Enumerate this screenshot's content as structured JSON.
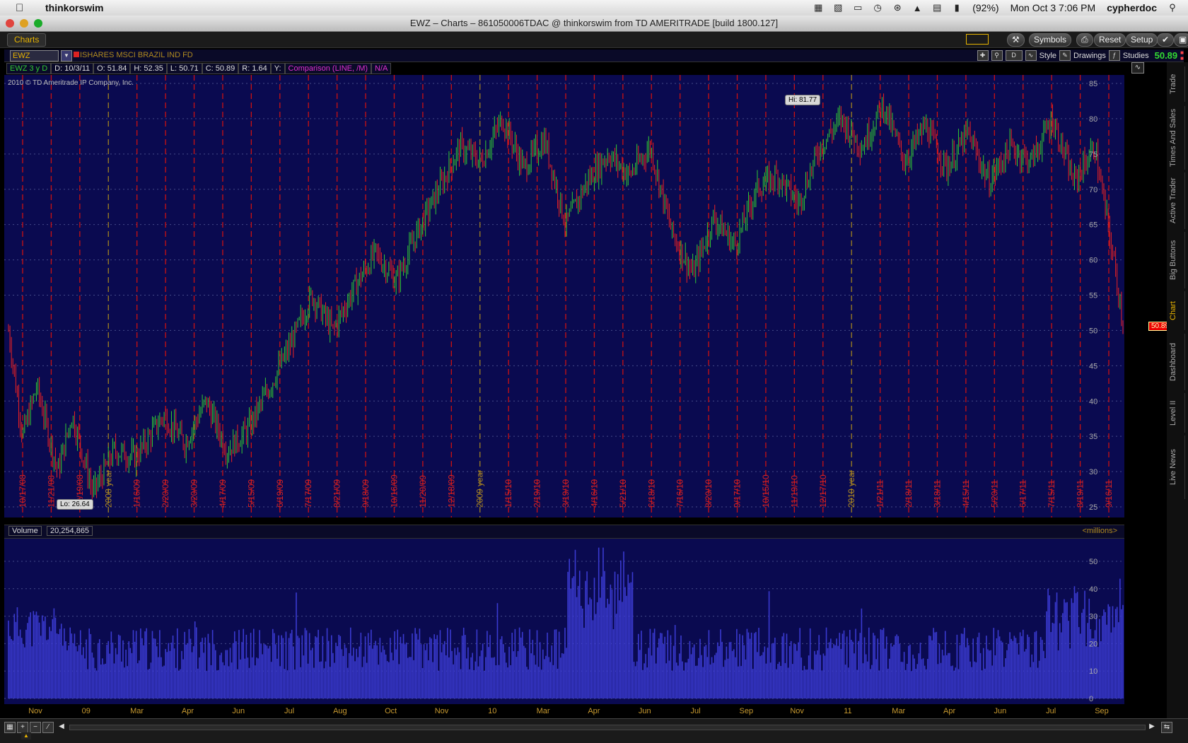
{
  "menubar": {
    "app_name": "thinkorswim",
    "battery": "(92%)",
    "datetime": "Mon Oct 3  7:06 PM",
    "user": "cypherdoc"
  },
  "window": {
    "title": "EWZ – Charts – 861050006TDAC @ thinkorswim from TD AMERITRADE [build 1800.127]"
  },
  "toolbar": {
    "tab_label": "Charts",
    "symbols_label": "Symbols",
    "reset_label": "Reset",
    "setup_label": "Setup"
  },
  "symbol_row": {
    "symbol": "EWZ",
    "description": "ISHARES MSCI BRAZIL IND FD",
    "period": "D",
    "style_label": "Style",
    "drawings_label": "Drawings",
    "studies_label": "Studies",
    "last_price": "50.89"
  },
  "info_row": {
    "chart_label": "EWZ 3 y D",
    "date": "D: 10/3/11",
    "open": "O: 51.84",
    "high": "H: 52.35",
    "low": "L: 50.71",
    "close": "C: 50.89",
    "range": "R: 1.64",
    "y_label": "Y:",
    "comparison": "Comparison (LINE, /M)",
    "na": "N/A"
  },
  "copyright": "2010 © TD Ameritrade IP Company, Inc.",
  "annotations": {
    "hi": "Hi: 81.77",
    "lo": "Lo: 26.64",
    "price_tag": "50.89"
  },
  "volume_panel": {
    "label": "Volume",
    "value": "20,254,865",
    "unit": "<millions>"
  },
  "side_tabs": [
    "Trade",
    "Times And Sales",
    "Active Trader",
    "Big Buttons",
    "Chart",
    "Dashboard",
    "Level II",
    "Live News"
  ],
  "colors": {
    "bg": "#0a0a50",
    "up": "#33cc33",
    "down": "#ee2222",
    "grid_red": "#cc1111",
    "volume": "#3a3ad0"
  },
  "chart_data": [
    {
      "type": "line",
      "price_axis": {
        "min": 25,
        "max": 85,
        "ticks": [
          25,
          30,
          35,
          40,
          45,
          50,
          55,
          60,
          65,
          70,
          75,
          80,
          85
        ]
      },
      "vertical_date_labels": [
        "10/17/08",
        "11/21/08",
        "12/19/08",
        "2008 year",
        "1/16/09",
        "2/20/09",
        "3/20/09",
        "4/17/09",
        "5/15/09",
        "6/19/09",
        "7/17/09",
        "8/21/09",
        "9/18/09",
        "10/16/09",
        "11/20/09",
        "12/18/09",
        "2009 year",
        "1/15/10",
        "2/19/10",
        "3/19/10",
        "4/16/10",
        "5/21/10",
        "6/18/10",
        "7/16/10",
        "8/20/10",
        "9/17/10",
        "10/15/10",
        "11/19/10",
        "12/17/10",
        "2010 year",
        "1/21/11",
        "2/18/11",
        "3/18/11",
        "4/15/11",
        "5/20/11",
        "6/17/11",
        "7/15/11",
        "8/19/11",
        "9/16/11"
      ],
      "series": [
        {
          "name": "",
          "x_index": [
            0,
            2,
            4,
            7,
            9,
            12,
            15,
            18,
            22,
            25,
            28,
            31,
            34,
            37,
            40,
            43,
            46,
            49,
            52,
            55,
            58,
            61,
            64,
            67,
            70,
            73,
            76,
            79,
            82,
            85,
            88,
            91,
            94,
            97,
            100,
            103,
            106,
            109,
            112,
            115,
            118,
            121,
            124,
            127,
            130,
            133,
            136,
            139,
            142,
            145,
            148,
            151,
            154,
            157,
            158
          ],
          "values": [
            50,
            35,
            42,
            30,
            38,
            27,
            33,
            32,
            38,
            34,
            40,
            33,
            36,
            42,
            48,
            55,
            50,
            56,
            61,
            57,
            64,
            70,
            76,
            74,
            80,
            73,
            77,
            65,
            71,
            75,
            72,
            76,
            64,
            58,
            66,
            62,
            70,
            72,
            68,
            76,
            80,
            76,
            82,
            74,
            79,
            73,
            78,
            71,
            76,
            74,
            80,
            71,
            76,
            58,
            51
          ]
        }
      ]
    },
    {
      "type": "bar",
      "volume_axis": {
        "min": 0,
        "max": 50,
        "ticks": [
          0,
          10,
          20,
          30,
          40,
          50
        ],
        "unit": "millions"
      },
      "month_labels": [
        "Nov",
        "09",
        "Mar",
        "Apr",
        "Jun",
        "Jul",
        "Aug",
        "Oct",
        "Nov",
        "10",
        "Mar",
        "Apr",
        "Jun",
        "Jul",
        "Sep",
        "Nov",
        "11",
        "Mar",
        "Apr",
        "Jun",
        "Jul",
        "Sep"
      ]
    }
  ]
}
